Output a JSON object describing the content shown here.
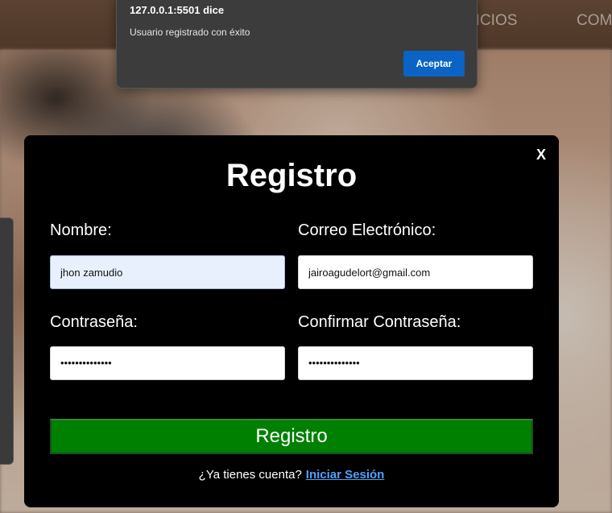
{
  "nav": {
    "servicios_label": "VICIOS",
    "como_label": "COMO"
  },
  "alert": {
    "origin": "127.0.0.1:5501 dice",
    "message": "Usuario registrado con éxito",
    "ok_label": "Aceptar"
  },
  "modal": {
    "close_label": "X",
    "title": "Registro",
    "fields": {
      "nombre": {
        "label": "Nombre:",
        "value": "jhon zamudio"
      },
      "correo": {
        "label": "Correo Electrónico:",
        "value": "jairoagudelort@gmail.com"
      },
      "password": {
        "label": "Contraseña:",
        "value": "••••••••••••••"
      },
      "confirm": {
        "label": "Confirmar Contraseña:",
        "value": "••••••••••••••"
      }
    },
    "submit_label": "Registro",
    "login_prompt": "¿Ya tienes cuenta?",
    "login_link": "Iniciar Sesión"
  },
  "colors": {
    "submit_bg": "#008000",
    "alert_button": "#0b63c5",
    "link": "#4da3ff",
    "autofill_bg": "#e8f0fe"
  }
}
